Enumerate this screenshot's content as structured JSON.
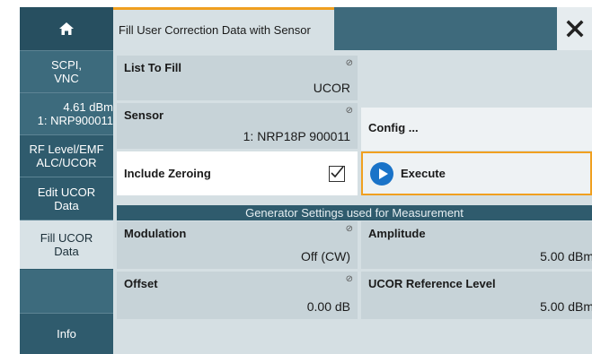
{
  "sidebar": {
    "home_icon": "home-icon",
    "items": [
      {
        "label": "SCPI,\nVNC"
      },
      {
        "level_value": "4.61 dBm",
        "level_sensor": "1: NRP900011"
      },
      {
        "label": "RF Level/EMF\nALC/UCOR"
      },
      {
        "label": "Edit UCOR\nData"
      },
      {
        "label": "Fill UCOR\nData"
      },
      {
        "label": ""
      },
      {
        "label": "Info"
      }
    ]
  },
  "header": {
    "tab_title": "Fill User Correction Data with Sensor",
    "close_glyph": "✕"
  },
  "fields": {
    "list_to_fill": {
      "label": "List To Fill",
      "value": "UCOR"
    },
    "sensor": {
      "label": "Sensor",
      "value": "1: NRP18P 900011"
    },
    "config_button": "Config ...",
    "include_zeroing": {
      "label": "Include Zeroing",
      "checked": true
    },
    "execute_button": "Execute",
    "generator_banner": "Generator Settings used for Measurement",
    "modulation": {
      "label": "Modulation",
      "value": "Off (CW)"
    },
    "amplitude": {
      "label": "Amplitude",
      "value": "5.00 dBm"
    },
    "offset": {
      "label": "Offset",
      "value": "0.00 dB"
    },
    "ucor_ref_level": {
      "label": "UCOR Reference Level",
      "value": "5.00 dBm"
    }
  },
  "colors": {
    "accent": "#f0a020",
    "sidebar_bg": "#2f5b6d",
    "field_bg": "#c7d3d8",
    "execute_icon": "#1a73c8"
  }
}
